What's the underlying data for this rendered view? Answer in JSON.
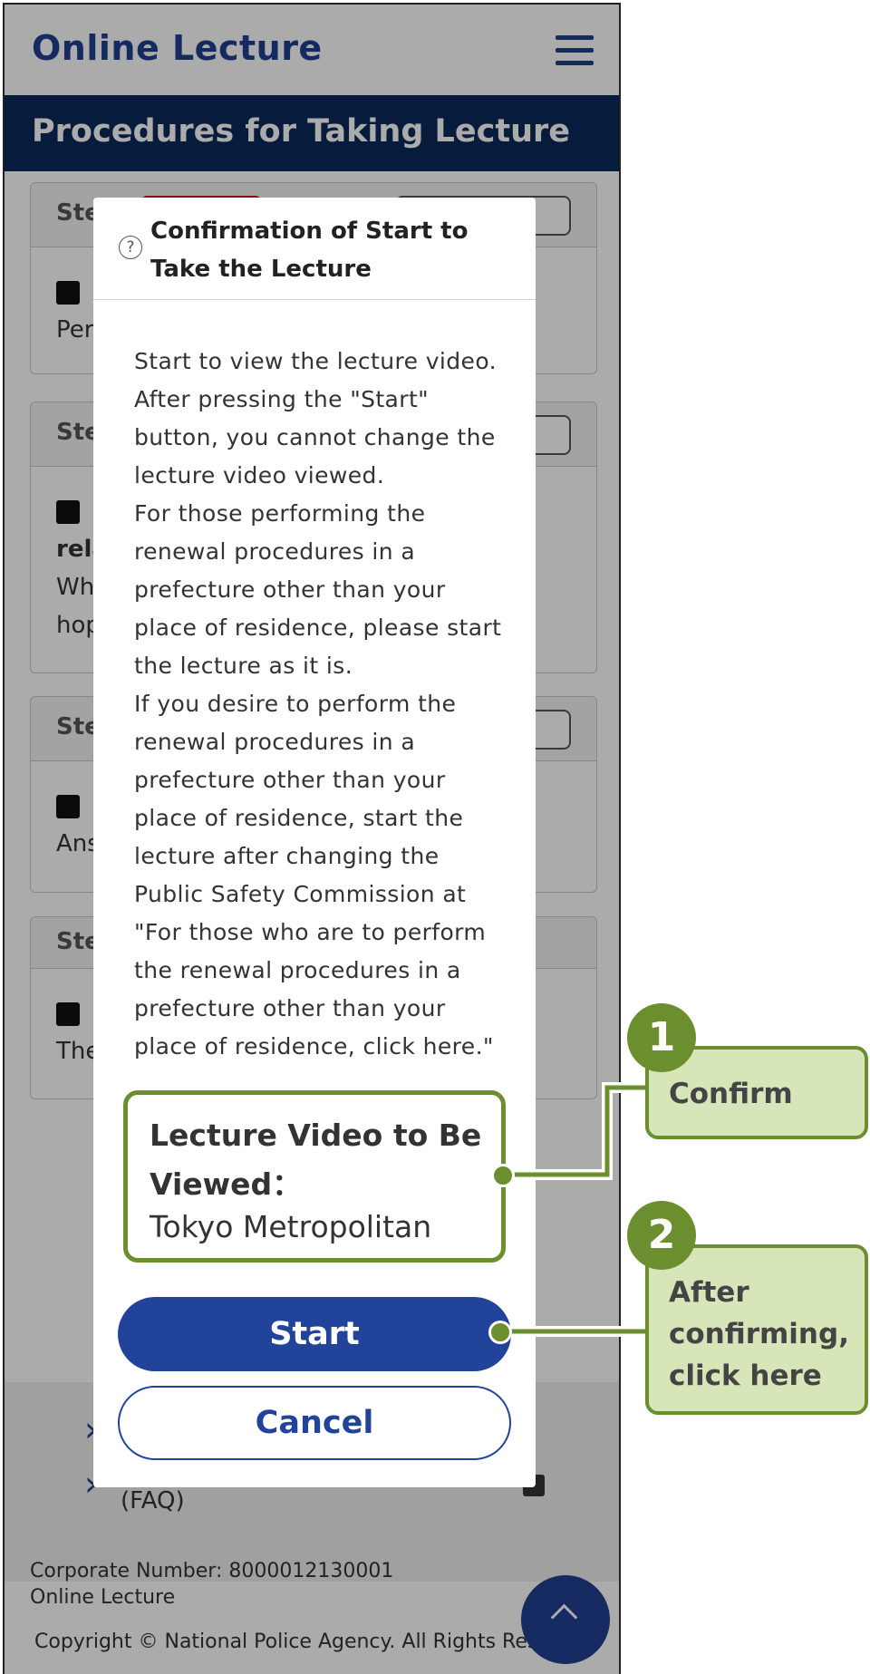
{
  "header": {
    "title": "Online Lecture"
  },
  "procedures_title": "Procedures for Taking Lecture",
  "steps": [
    {
      "label": "Ste",
      "body": [
        "Per"
      ]
    },
    {
      "label": "Ste",
      "body": [
        "rela",
        "Wh",
        "hop"
      ]
    },
    {
      "label": "Ste",
      "body": [
        "Ans"
      ]
    },
    {
      "label": "Ste",
      "body": [
        "The"
      ]
    }
  ],
  "modal": {
    "help_icon": "?",
    "title": "Confirmation of Start to Take the Lecture",
    "message": [
      "Start to view the lecture video.",
      "After pressing the \"Start\" button, you cannot change the lecture video viewed.",
      "For those performing the renewal procedures in a prefecture other than your place of residence, please start the lecture as it is.",
      "If you desire to perform the renewal procedures in a prefecture other than your place of residence, start the lecture after changing the Public Safety Commission at \"For those who are to perform the renewal procedures in a prefecture other than your place of residence, click here.\""
    ],
    "video_label": "Lecture Video to Be Viewed：",
    "video_value": "Tokyo Metropolitan",
    "start_label": "Start",
    "cancel_label": "Cancel"
  },
  "footer": {
    "faq_text": "(FAQ)",
    "corporate_number": "Corporate Number: 8000012130001",
    "site_name": "Online Lecture",
    "copyright": "Copyright © National Police Agency. All Rights Reserv"
  },
  "annotations": [
    {
      "number": "1",
      "text": "Confirm"
    },
    {
      "number": "2",
      "text": "After confirming, click here"
    }
  ],
  "colors": {
    "brand_blue": "#1f3f8f",
    "header_navy": "#0b2b5c",
    "button_blue": "#21449a",
    "annotation_green": "#6b8f2f",
    "annotation_fill": "#d6e6b8"
  }
}
